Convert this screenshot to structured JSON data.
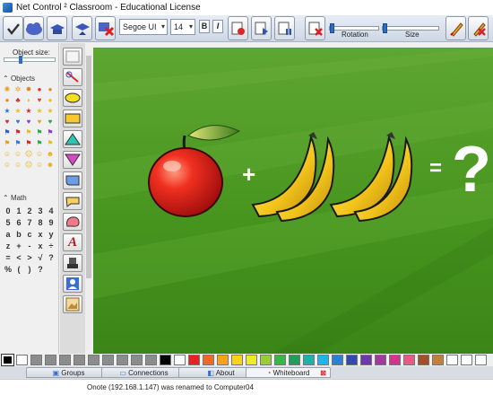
{
  "window": {
    "title": "Net Control ² Classroom - Educational License"
  },
  "toolbar": {
    "font_value": "Segoe UI",
    "size_value": "14",
    "bold_label": "B",
    "italic_label": "I",
    "rotation_label": "Rotation",
    "size_label": "Size"
  },
  "left_panel": {
    "object_size_label": "Object size:",
    "objects_header": "Objects",
    "math_header": "Math",
    "math_symbols": [
      "0",
      "1",
      "2",
      "3",
      "4",
      "5",
      "6",
      "7",
      "8",
      "9",
      "a",
      "b",
      "c",
      "x",
      "y",
      "z",
      "+",
      "-",
      "x",
      "÷",
      "=",
      "<",
      ">",
      "√",
      "?",
      "%",
      "(",
      ")",
      "?"
    ]
  },
  "canvas": {
    "plus_sign": "+",
    "equals_sign": "=",
    "question_mark": "?"
  },
  "tabs": [
    {
      "label": "Groups"
    },
    {
      "label": "Connections"
    },
    {
      "label": "About"
    },
    {
      "label": "Whiteboard"
    }
  ],
  "status": {
    "text": "Onote (192.168.1.147) was renamed to Computer04"
  },
  "colors": {
    "palette": [
      "#000000",
      "#ffffff",
      "#8c8c8c",
      "#8c8c8c",
      "#8c8c8c",
      "#8c8c8c",
      "#8c8c8c",
      "#8c8c8c",
      "#8c8c8c",
      "#8c8c8c",
      "#8c8c8c",
      "#000000",
      "#ffffff",
      "#e62026",
      "#f26a22",
      "#f7a21b",
      "#fbd31a",
      "#ecec2a",
      "#9acd32",
      "#3bb54a",
      "#1e9e5a",
      "#20b2aa",
      "#1fb5e8",
      "#2f7fd8",
      "#3649b3",
      "#6c3aa8",
      "#a23ba0",
      "#d6338c",
      "#ec5a84",
      "#a0522d",
      "#c08040",
      "#ffffff",
      "#ffffff",
      "#ffffff"
    ]
  }
}
